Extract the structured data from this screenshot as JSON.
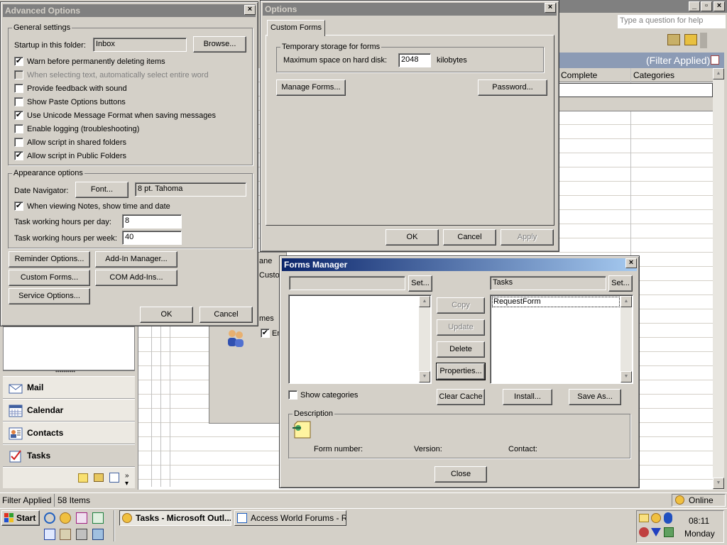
{
  "background": {
    "help_placeholder": "Type a question for help",
    "filter_label": "(Filter Applied)",
    "col_complete": "Complete",
    "col_categories": "Categories",
    "partial_pane": "ane",
    "partial_custom": "Custo",
    "partial_mes": "mes",
    "partial_en": "En"
  },
  "nav": {
    "items": [
      {
        "label": "Mail",
        "icon": "mail-icon"
      },
      {
        "label": "Calendar",
        "icon": "calendar-icon"
      },
      {
        "label": "Contacts",
        "icon": "contacts-icon"
      },
      {
        "label": "Tasks",
        "icon": "tasks-icon"
      }
    ]
  },
  "status": {
    "filter": "Filter Applied",
    "items": "58 Items",
    "online": "Online"
  },
  "advanced": {
    "title": "Advanced Options",
    "general_group": "General settings",
    "startup_label": "Startup in this folder:",
    "startup_value": "Inbox",
    "browse": "Browse...",
    "checks": [
      {
        "label": "Warn before permanently deleting items",
        "checked": true,
        "disabled": false
      },
      {
        "label": "When selecting text, automatically select entire word",
        "checked": false,
        "disabled": true
      },
      {
        "label": "Provide feedback with sound",
        "checked": false,
        "disabled": false
      },
      {
        "label": "Show Paste Options buttons",
        "checked": false,
        "disabled": false
      },
      {
        "label": "Use Unicode Message Format when saving messages",
        "checked": true,
        "disabled": false
      },
      {
        "label": "Enable logging (troubleshooting)",
        "checked": false,
        "disabled": false
      },
      {
        "label": "Allow script in shared folders",
        "checked": false,
        "disabled": false
      },
      {
        "label": "Allow script in Public Folders",
        "checked": true,
        "disabled": false
      }
    ],
    "appearance_group": "Appearance options",
    "date_nav_label": "Date Navigator:",
    "font_btn": "Font...",
    "font_value": "8 pt. Tahoma",
    "notes_check": "When viewing Notes, show time and date",
    "hours_day_label": "Task working hours per day:",
    "hours_day_value": "8",
    "hours_week_label": "Task working hours per week:",
    "hours_week_value": "40",
    "reminder_btn": "Reminder Options...",
    "addin_btn": "Add-In Manager...",
    "custom_forms_btn": "Custom Forms...",
    "com_btn": "COM Add-Ins...",
    "service_btn": "Service Options...",
    "ok": "OK",
    "cancel": "Cancel"
  },
  "options": {
    "title": "Options",
    "tab": "Custom Forms",
    "storage_group": "Temporary storage for forms",
    "max_label": "Maximum space on hard disk:",
    "max_value": "2048",
    "unit": "kilobytes",
    "manage_btn": "Manage Forms...",
    "password_btn": "Password...",
    "ok": "OK",
    "cancel": "Cancel",
    "apply": "Apply"
  },
  "forms": {
    "title": "Forms Manager",
    "left_set": "Set...",
    "right_folder": "Tasks",
    "right_set": "Set...",
    "right_items": [
      "RequestForm"
    ],
    "copy": "Copy",
    "update": "Update",
    "delete": "Delete",
    "properties": "Properties...",
    "show_categories": "Show categories",
    "clear_cache": "Clear Cache",
    "install": "Install...",
    "save_as": "Save As...",
    "desc_group": "Description",
    "form_number": "Form number:",
    "version": "Version:",
    "contact": "Contact:",
    "close": "Close"
  },
  "taskbar": {
    "start": "Start",
    "tasks": [
      {
        "label": "Tasks - Microsoft Outl...",
        "active": true
      },
      {
        "label": "Access World Forums - R...",
        "active": false
      }
    ],
    "time": "08:11",
    "day": "Monday"
  }
}
